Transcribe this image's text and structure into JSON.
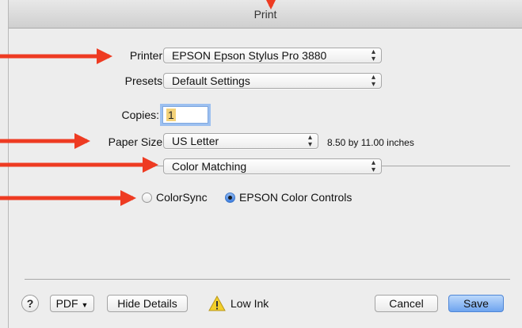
{
  "window": {
    "title": "Print"
  },
  "form": {
    "printer_label": "Printer:",
    "printer_value": "EPSON Epson Stylus Pro 3880",
    "presets_label": "Presets:",
    "presets_value": "Default Settings",
    "copies_label": "Copies:",
    "copies_value": "1",
    "paper_size_label": "Paper Size:",
    "paper_size_value": "US Letter",
    "paper_size_info": "8.50 by 11.00 inches",
    "section_value": "Color Matching"
  },
  "color_options": {
    "colorsync_label": "ColorSync",
    "epson_label": "EPSON Color Controls",
    "selected": "EPSON Color Controls"
  },
  "footer": {
    "help_label": "?",
    "pdf_label": "PDF",
    "hide_details_label": "Hide Details",
    "low_ink_label": "Low Ink",
    "cancel_label": "Cancel",
    "save_label": "Save"
  },
  "annotations": {
    "arrow_color": "#ee3b22"
  },
  "icons": {
    "popup": "updown-chevron-icon",
    "warning": "warning-triangle-icon",
    "pdf_menu": "triangle-down-icon"
  }
}
